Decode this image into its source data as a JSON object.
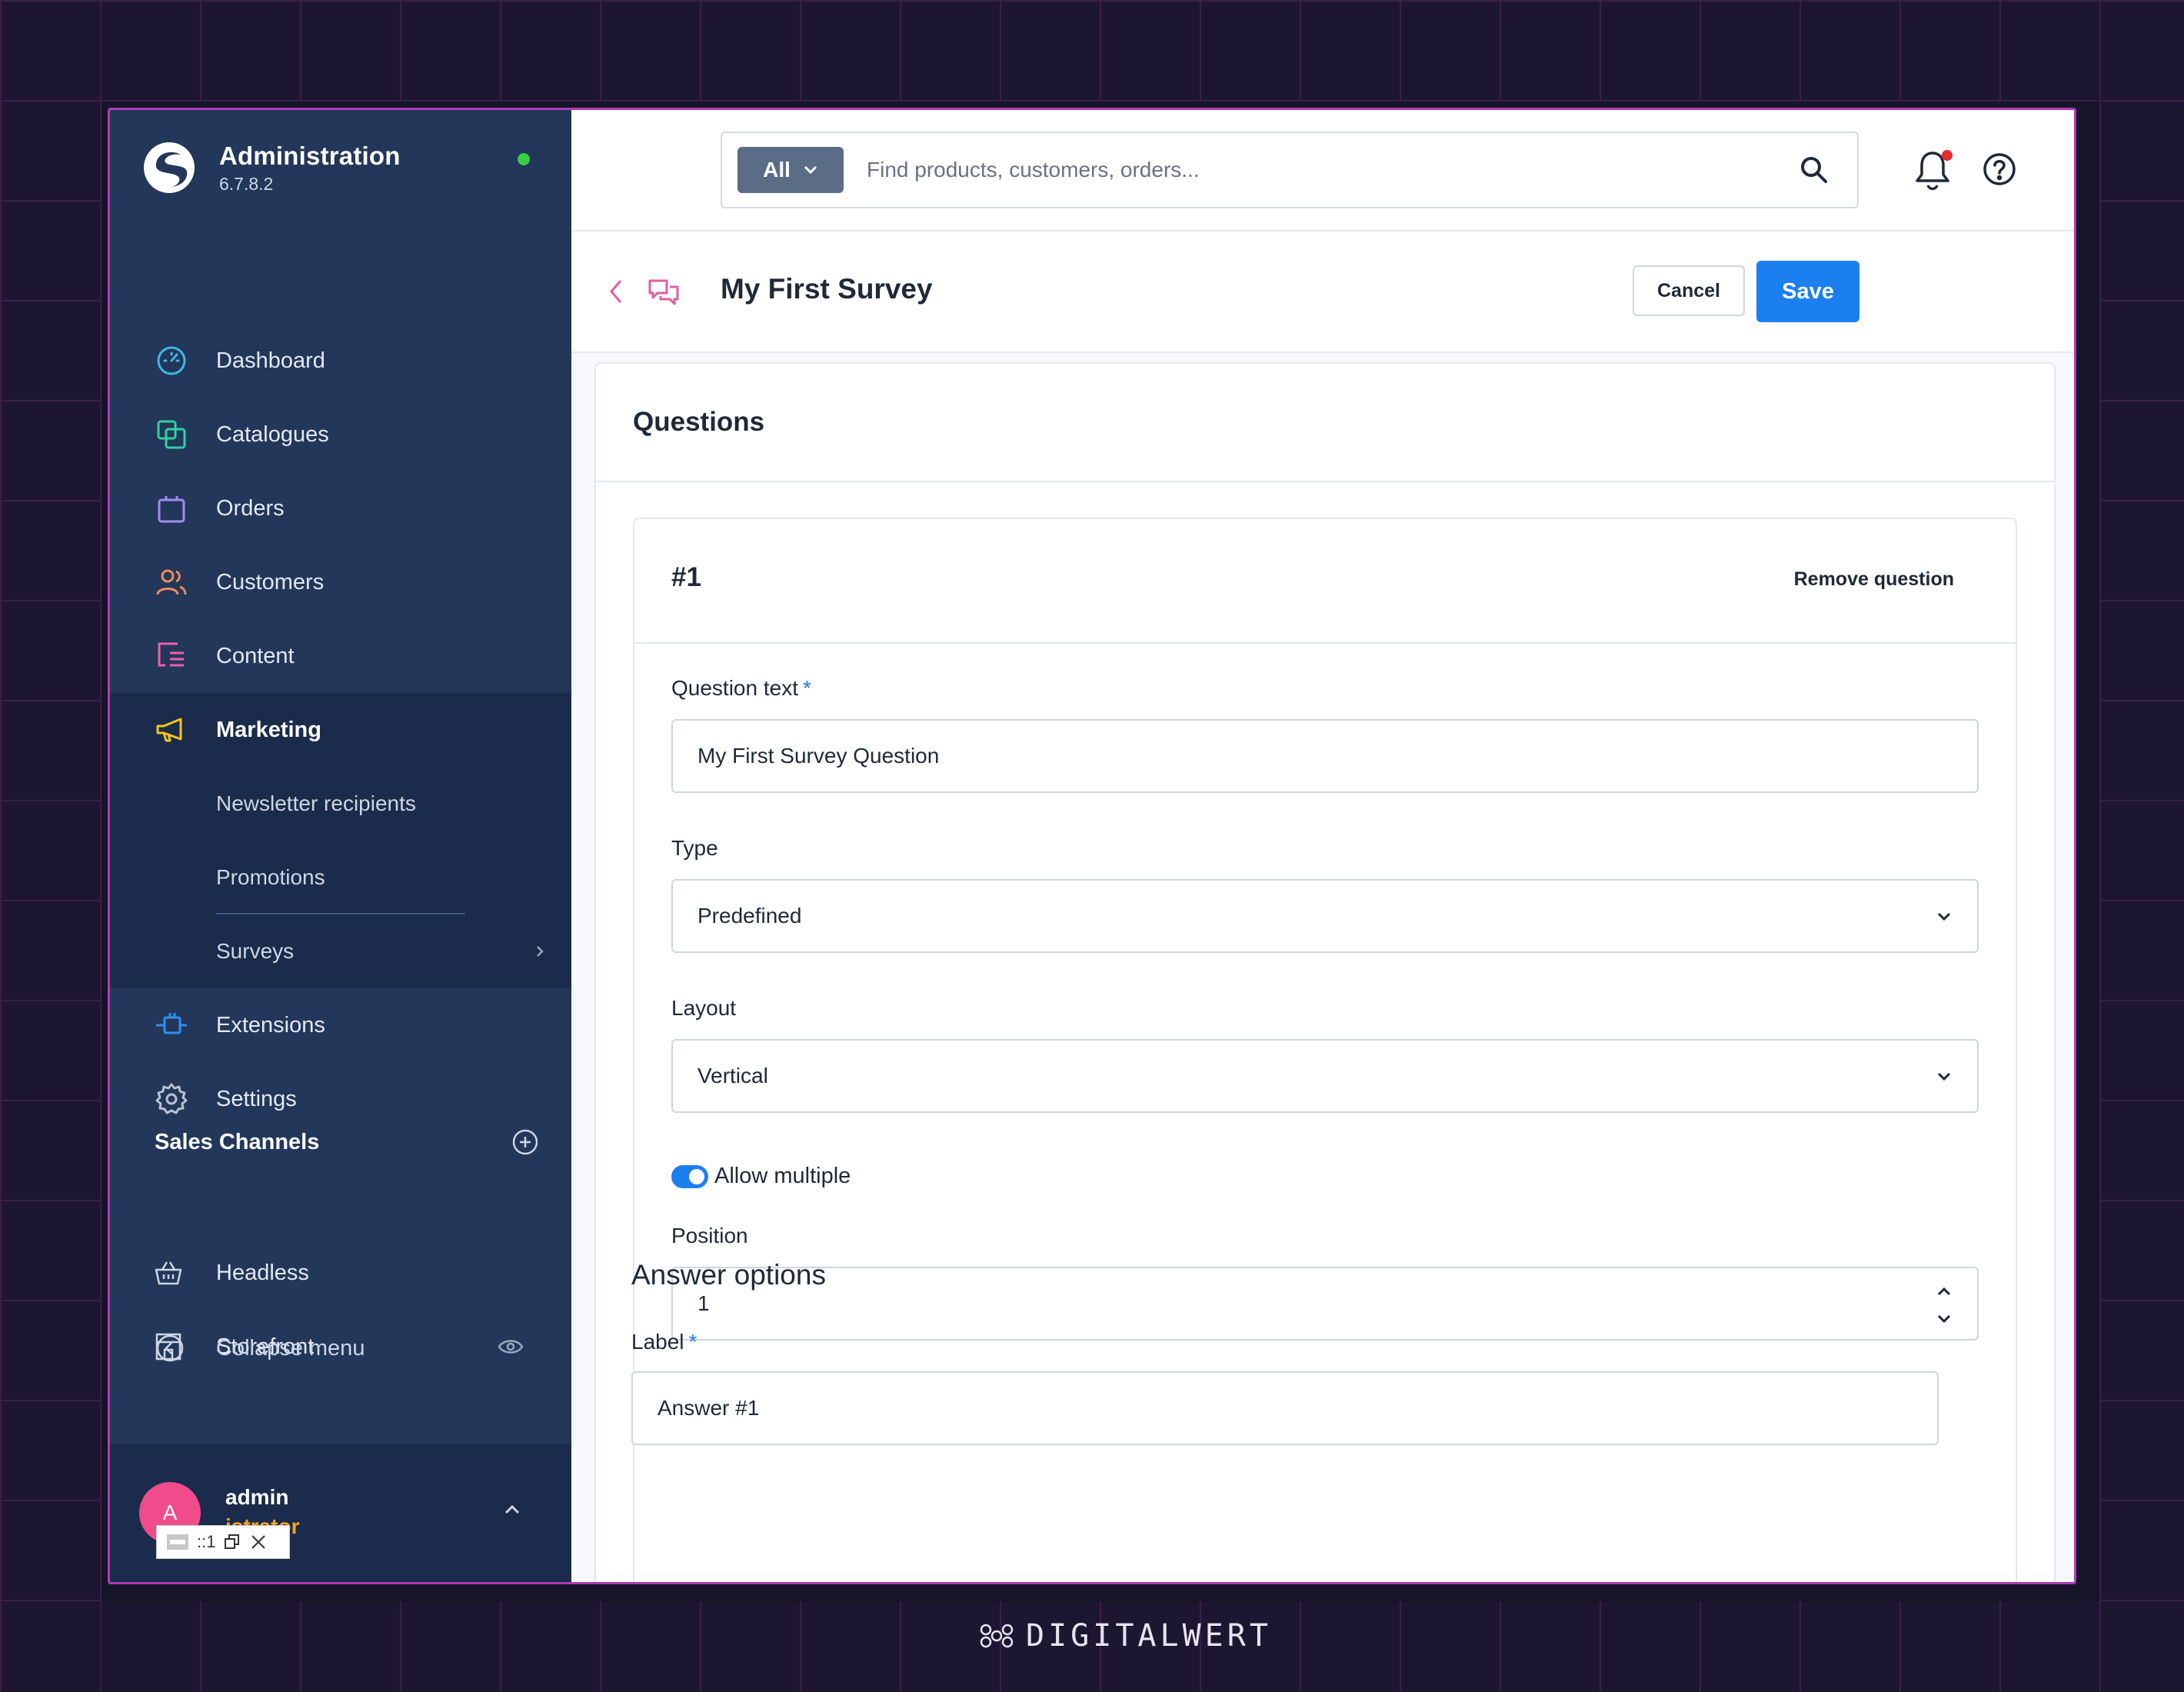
{
  "brand": {
    "title": "Administration",
    "version": "6.7.8.2"
  },
  "nav": {
    "dashboard": "Dashboard",
    "catalogues": "Catalogues",
    "orders": "Orders",
    "customers": "Customers",
    "content": "Content",
    "marketing": "Marketing",
    "newsletter": "Newsletter recipients",
    "promotions": "Promotions",
    "surveys": "Surveys",
    "extensions": "Extensions",
    "settings": "Settings"
  },
  "sales_channels": {
    "title": "Sales Channels",
    "items": [
      "Headless",
      "Storefront"
    ]
  },
  "collapse_label": "Collapse menu",
  "user": {
    "name": "admin",
    "role": "istrator",
    "initial": "A"
  },
  "mini_toolbar": {
    "text": "::1"
  },
  "search": {
    "scope": "All",
    "placeholder": "Find products, customers, orders..."
  },
  "page": {
    "title": "My First Survey",
    "cancel": "Cancel",
    "save": "Save"
  },
  "questions": {
    "title": "Questions",
    "number": "#1",
    "remove": "Remove question",
    "question_text_label": "Question text",
    "question_text_value": "My First Survey Question",
    "type_label": "Type",
    "type_value": "Predefined",
    "layout_label": "Layout",
    "layout_value": "Vertical",
    "allow_multiple_label": "Allow multiple",
    "allow_multiple_on": true,
    "position_label": "Position",
    "position_value": "1",
    "answer_options_title": "Answer options",
    "answer_label": "Label",
    "answer_value": "Answer #1",
    "required_mark": "*"
  },
  "footer_brand": "DIGITALWERT",
  "colors": {
    "sidebar": "#22375a",
    "accent": "#1c7ff0",
    "frame": "#b03ab8",
    "online": "#37d046"
  }
}
